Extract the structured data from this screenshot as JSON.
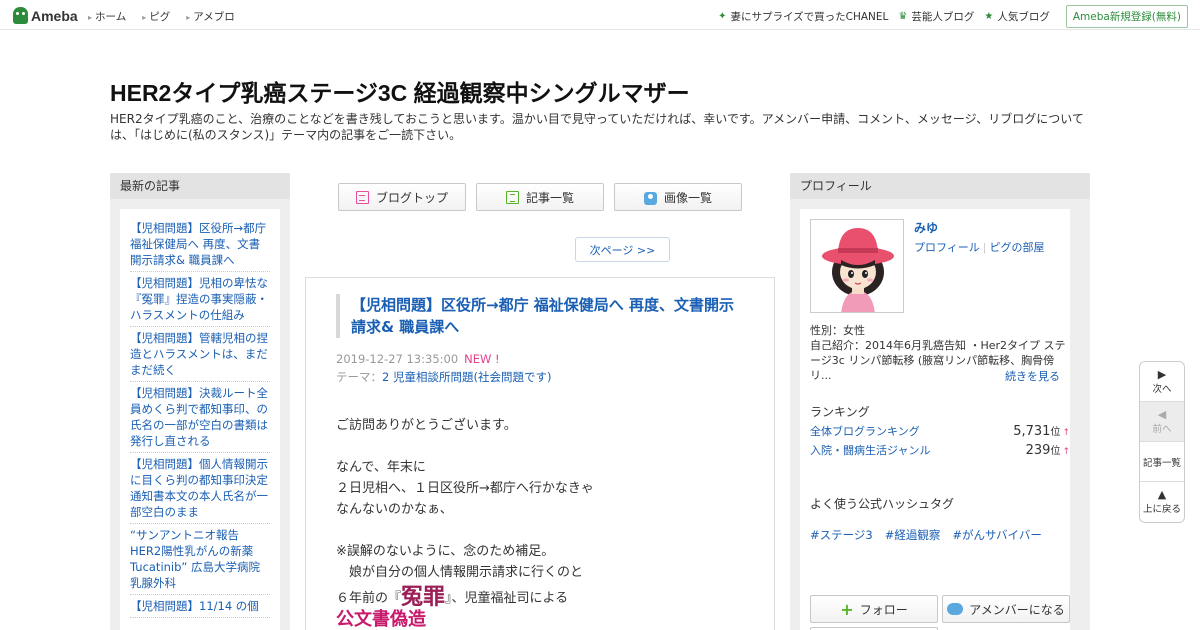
{
  "topbar": {
    "logo": "Ameba",
    "nav": [
      "ホーム",
      "ピグ",
      "アメブロ"
    ],
    "right_links": [
      {
        "icon": "sparkle-icon",
        "label": "妻にサプライズで買ったCHANEL"
      },
      {
        "icon": "crown-icon",
        "label": "芸能人ブログ"
      },
      {
        "icon": "star-icon",
        "label": "人気ブログ"
      }
    ],
    "register": "Ameba新規登録(無料)"
  },
  "header": {
    "title": "HER2タイプ乳癌ステージ3C 経過観察中シングルマザー",
    "description": "HER2タイプ乳癌のこと、治療のことなどを書き残しておこうと思います。温かい目で見守っていただければ、幸いです。アメンバー申請、コメント、メッセージ、リブログについては、「はじめに(私のスタンス)」テーマ内の記事をご一読下さい。"
  },
  "left": {
    "heading": "最新の記事",
    "items": [
      "【児相問題】区役所→都庁 福祉保健局へ 再度、文書開示請求& 職員課へ",
      "【児相問題】児相の卑怯な『冤罪』捏造の事実隠蔽・ハラスメントの仕組み",
      "【児相問題】管轄児相の捏造とハラスメントは、まだまだ続く",
      "【児相問題】決裁ルート全員めくら判で都知事印、の氏名の一部が空白の書類は発行し直される",
      "【児相問題】個人情報開示に目くら判の都知事印決定通知書本文の本人氏名が一部空白のまま",
      "“サンアントニオ報告 HER2陽性乳がんの新薬Tucatinib” 広島大学病院 乳腺外科",
      "【児相問題】11/14 の個"
    ]
  },
  "tabs": [
    {
      "icon": "document-icon",
      "label": "ブログトップ"
    },
    {
      "icon": "list-icon",
      "label": "記事一覧"
    },
    {
      "icon": "camera-icon",
      "label": "画像一覧"
    }
  ],
  "pager": {
    "next": "次ページ >>"
  },
  "article": {
    "title": "【児相問題】区役所→都庁 福祉保健局へ 再度、文書開示請求& 職員課へ",
    "date": "2019-12-27 13:35:00",
    "new_badge": "NEW !",
    "theme_label": "テーマ：",
    "theme": "2 児童相談所問題(社会問題です)",
    "body": {
      "p1": "ご訪問ありがとうございます。",
      "p2": "なんで、年末に",
      "p3": "２日児相へ、１日区役所→都庁へ行かなきゃ",
      "p4": "なんないのかなぁ、",
      "p5": "※誤解のないように、念のため補足。",
      "p6": "　娘が自分の個人情報開示請求に行くのと",
      "p7_pre": "６年前の『",
      "p7_word": "冤罪",
      "p7_post": "』、児童福祉司による",
      "p8": "公文書偽造"
    }
  },
  "profile": {
    "heading": "プロフィール",
    "name": "みゆ",
    "link1": "プロフィール",
    "link2": "ピグの部屋",
    "sex": "性別：女性",
    "intro": "自己紹介：2014年6月乳癌告知 ・Her2タイプ ステージ3c リンパ節転移 (腋窩リンパ節転移、胸骨傍リ...",
    "more": "続きを見る",
    "ranking_heading": "ランキング",
    "rankings": [
      {
        "label": "全体ブログランキング",
        "value": "5,731",
        "unit": "位",
        "arrow": "↑"
      },
      {
        "label": "入院・闘病生活ジャンル",
        "value": "239",
        "unit": "位",
        "arrow": "↑"
      }
    ],
    "hashtag_heading": "よく使う公式ハッシュタグ",
    "hashtags": [
      "#ステージ3",
      "#経過観察",
      "#がんサバイバー"
    ],
    "follow": "フォロー",
    "amember": "アメンバーになる"
  },
  "sidenav": {
    "next": "次へ",
    "prev": "前へ",
    "list": "記事一覧",
    "top": "上に戻る"
  }
}
